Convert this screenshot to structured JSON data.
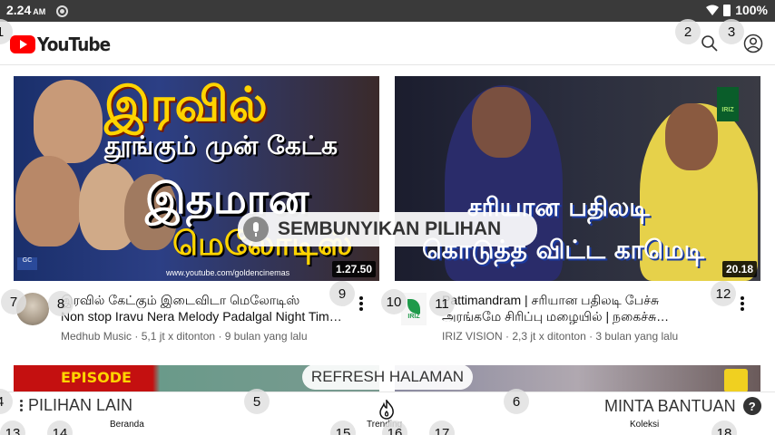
{
  "status_bar": {
    "time": "2.24",
    "ampm": "AM",
    "battery": "100%"
  },
  "header": {
    "logo_text": "YouTube",
    "search_icon": "search-icon",
    "account_icon": "account-icon"
  },
  "videos": [
    {
      "thumb_line1": "இரவில்",
      "thumb_line2": "தூங்கும் முன் கேட்க",
      "thumb_line3": "இதமான",
      "thumb_line4": "மெலோடிஸ்",
      "thumb_url": "www.youtube.com/goldencinemas",
      "duration": "1.27.50",
      "title": "இரவில் கேட்கும் இடைவிடா மெலோடிஸ்",
      "title_line2": "Non stop Iravu Nera Melody Padalgal Night Tim…",
      "channel": "Medhub Music",
      "views": "5,1 jt x ditonton",
      "age": "9 bulan yang lalu"
    },
    {
      "thumb_line1": "சரியான பதிலடி",
      "thumb_line2": "கொடுத்த விட்ட காமெடி",
      "thumb_logo": "IRIZ",
      "duration": "20.18",
      "title": "Pattimandram | சரியான பதிலடி பேச்சு",
      "title_line2": "அரங்கமே சிரிப்பு மழையில் | நகைச்சு…",
      "channel": "IRIZ VISION",
      "views": "2,3 jt x ditonton",
      "age": "3 bulan yang lalu"
    }
  ],
  "row2": {
    "label_a": "EPISODE"
  },
  "overlay": {
    "hide_options": "SEMBUNYIKAN PILIHAN",
    "refresh": "REFRESH HALAMAN",
    "more_options": "PILIHAN LAIN",
    "help": "MINTA BANTUAN",
    "help_glyph": "?"
  },
  "bottom_nav": {
    "home": "Beranda",
    "trending": "Trending",
    "library": "Koleksi"
  },
  "markers": [
    "1",
    "2",
    "3",
    "4",
    "5",
    "6",
    "7",
    "8",
    "9",
    "10",
    "11",
    "12",
    "13",
    "14",
    "15",
    "16",
    "17",
    "18"
  ],
  "colors": {
    "brand_red": "#ff0000",
    "status_bar": "#3a3a3a",
    "meta_gray": "#606060"
  }
}
